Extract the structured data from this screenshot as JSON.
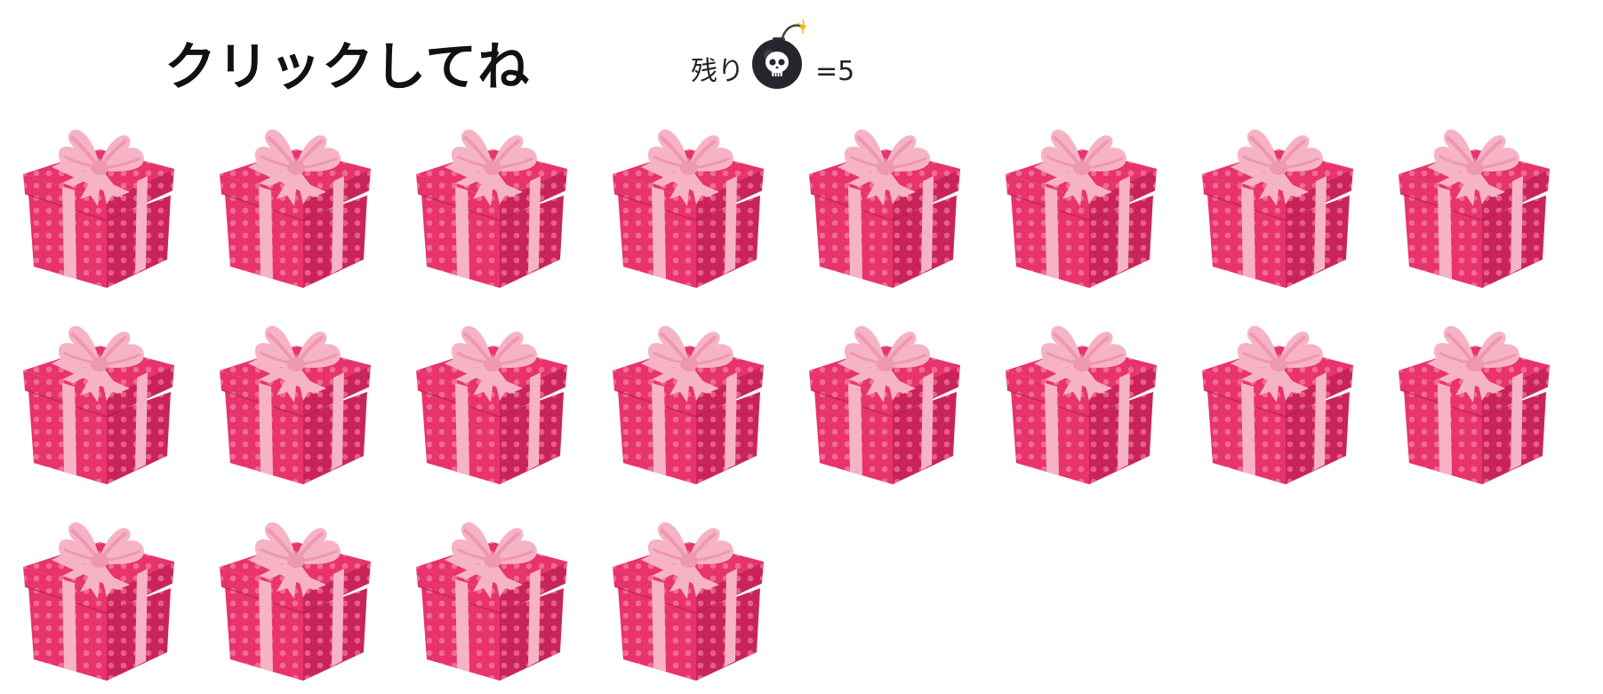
{
  "header": {
    "title": "クリックしてね",
    "remaining_label": "残り",
    "remaining_eq": "=",
    "remaining_count": "5",
    "bomb_icon": "bomb-skull-icon"
  },
  "board": {
    "gift_count": 20,
    "columns": 8,
    "gift_icon": "gift-box-icon",
    "colors": {
      "box": "#e8336d",
      "box_dark": "#c9245a",
      "dots": "#f06b95",
      "ribbon": "#f6b3c6",
      "ribbon_shade": "#ee97b1"
    }
  }
}
